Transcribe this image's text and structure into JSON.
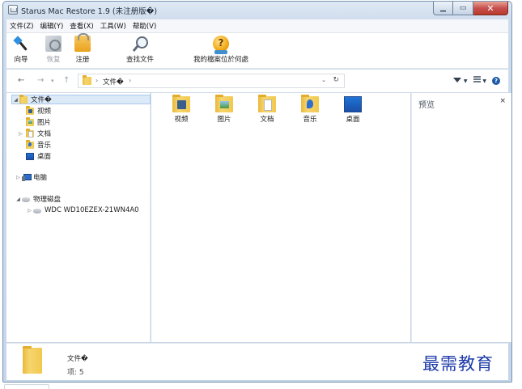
{
  "window": {
    "title": "Starus Mac Restore 1.9 (未注册版�)"
  },
  "menu": [
    "文件(Z)",
    "编辑(Y)",
    "查看(X)",
    "工具(W)",
    "帮助(V)"
  ],
  "toolbar": {
    "wizard": "向导",
    "recover": "恢复",
    "register": "注册",
    "search": "查找文件",
    "find_case": "我的檔案位於何處"
  },
  "address": {
    "path": "文件�",
    "refresh_glyph": "↻",
    "dropdown_glyph": "⌄"
  },
  "tree": {
    "root": "文件�",
    "children": [
      "视频",
      "图片",
      "文档",
      "音乐",
      "桌面"
    ],
    "computer": "电脑",
    "physical_disks": "物理磁盘",
    "disk": "WDC WD10EZEX-21WN4A0"
  },
  "items": [
    {
      "label": "视频",
      "icon": "folder-video-icon"
    },
    {
      "label": "图片",
      "icon": "folder-pictures-icon"
    },
    {
      "label": "文档",
      "icon": "folder-documents-icon"
    },
    {
      "label": "音乐",
      "icon": "folder-music-icon"
    },
    {
      "label": "桌面",
      "icon": "desktop-icon"
    }
  ],
  "preview": {
    "title": "预览"
  },
  "details": {
    "name": "文件�",
    "count": "项: 5"
  },
  "watermark": "最需教育",
  "colors": {
    "selection": "#dceaf8",
    "frame": "#c6d5e8",
    "close": "#c75050"
  }
}
